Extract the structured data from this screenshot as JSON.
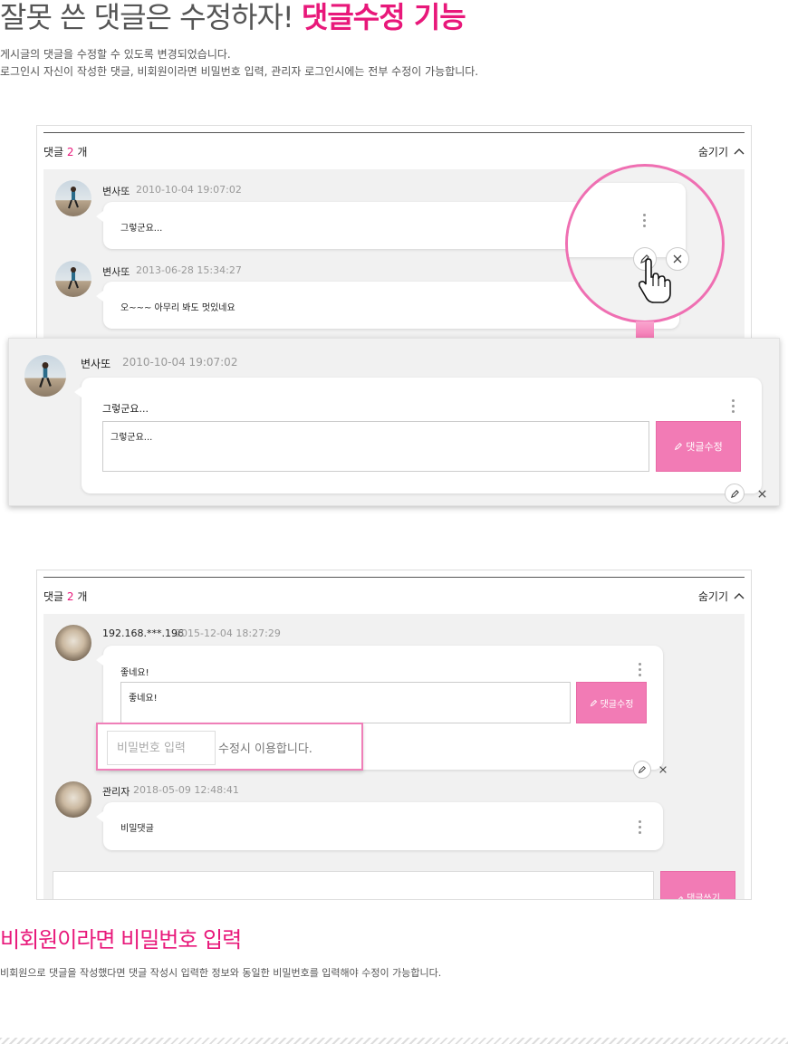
{
  "header": {
    "title_plain": "잘못 쓴 댓글은 수정하자!",
    "title_highlight": "댓글수정 기능",
    "desc_line1": "게시글의 댓글을 수정할 수 있도록 변경되었습니다.",
    "desc_line2": "로그인시 자신이 작성한 댓글, 비회원이라면 비밀번호 입력, 관리자 로그인시에는 전부 수정이 가능합니다."
  },
  "example1": {
    "comment_label": "댓글",
    "comment_count": "2",
    "comment_unit": "개",
    "hide_label": "숨기기",
    "comments": [
      {
        "author": "변사또",
        "date": "2010-10-04 19:07:02",
        "text": "그렇군요..."
      },
      {
        "author": "변사또",
        "date": "2013-06-28 15:34:27",
        "text": "오~~~ 아무리 봐도 멋있네요"
      }
    ],
    "edit_view": {
      "author": "변사또",
      "date": "2010-10-04 19:07:02",
      "text": "그렇군요...",
      "textarea_value": "그렇군요...",
      "submit_label": "댓글수정"
    }
  },
  "example2": {
    "comment_label": "댓글",
    "comment_count": "2",
    "comment_unit": "개",
    "hide_label": "숨기기",
    "comments": [
      {
        "author": "192.168.***.196",
        "date": "2015-12-04 18:27:29",
        "text": "좋네요!",
        "textarea_value": "좋네요!",
        "submit_label": "댓글수정"
      },
      {
        "author": "관리자",
        "date": "2018-05-09 12:48:41",
        "text": "비밀댓글"
      }
    ],
    "password_placeholder": "비밀번호 입력",
    "password_hint": "수정시 이용합니다.",
    "write_button": "댓글쓰기"
  },
  "section2": {
    "title": "비회원이라면 비밀번호 입력",
    "desc": "비회원으로 댓글을 작성했다면 댓글 작성시 입력한 정보와 동일한 비밀번호를 입력해야 수정이 가능합니다."
  },
  "colors": {
    "accent": "#e8187a",
    "button_pink": "#f27bb5",
    "panel_gray": "#f1f1f1"
  },
  "icons": [
    "pencil-icon",
    "close-icon",
    "more-vertical-icon",
    "chevron-up-icon",
    "hand-pointer-icon",
    "arrow-down-icon"
  ]
}
